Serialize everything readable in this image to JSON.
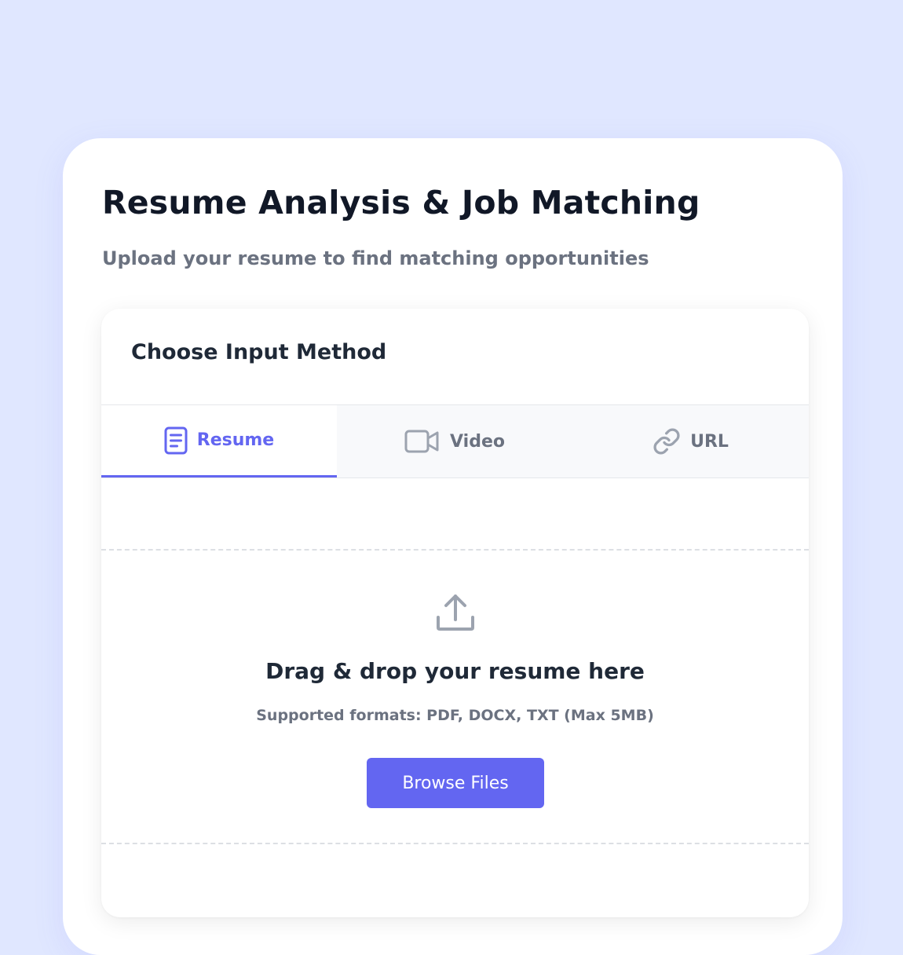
{
  "page": {
    "title": "Resume Analysis & Job Matching",
    "subtitle": "Upload your resume to find matching opportunities"
  },
  "input_method": {
    "heading": "Choose Input Method",
    "tabs": [
      {
        "label": "Resume",
        "icon": "document-icon",
        "active": true
      },
      {
        "label": "Video",
        "icon": "video-camera-icon",
        "active": false
      },
      {
        "label": "URL",
        "icon": "link-icon",
        "active": false
      }
    ]
  },
  "dropzone": {
    "icon": "upload-icon",
    "title": "Drag & drop your resume here",
    "formats": "Supported formats: PDF, DOCX, TXT (Max 5MB)",
    "button_label": "Browse Files"
  },
  "colors": {
    "background": "#e0e7ff",
    "accent": "#6366f1",
    "text_primary": "#111827",
    "text_muted": "#6b7280"
  }
}
